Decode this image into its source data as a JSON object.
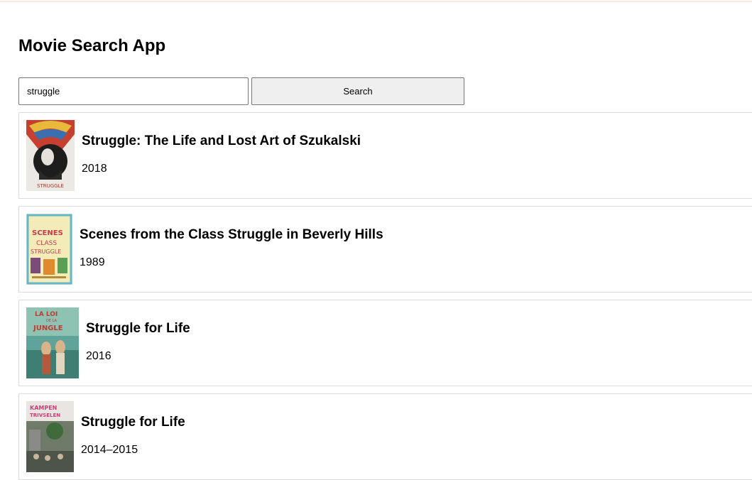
{
  "app": {
    "title": "Movie Search App"
  },
  "search": {
    "value": "struggle",
    "button_label": "Search"
  },
  "results": [
    {
      "title": "Struggle: The Life and Lost Art of Szukalski",
      "year": "2018",
      "poster_text": "STRUGGLE"
    },
    {
      "title": "Scenes from the Class Struggle in Beverly Hills",
      "year": "1989",
      "poster_text": "SCENES CLASS STRUGGLE"
    },
    {
      "title": "Struggle for Life",
      "year": "2016",
      "poster_text": "LA LOI DE LA JUNGLE"
    },
    {
      "title": "Struggle for Life",
      "year": "2014–2015",
      "poster_text": "KAMPEN for TRIVSELEN"
    }
  ]
}
